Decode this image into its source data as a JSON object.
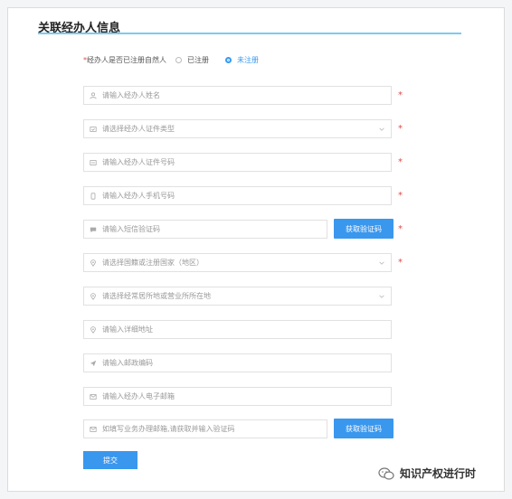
{
  "section": {
    "title": "关联经办人信息"
  },
  "registration": {
    "required_mark": "*",
    "label": "经办人是否已注册自然人",
    "options": [
      "已注册",
      "未注册"
    ],
    "selected": "未注册"
  },
  "form": {
    "fields": [
      {
        "placeholder": "请输入经办人姓名",
        "icon": "user-icon",
        "required": true
      },
      {
        "placeholder": "请选择经办人证件类型",
        "icon": "id-card-icon",
        "required": true,
        "dropdown": true
      },
      {
        "placeholder": "请输入经办人证件号码",
        "icon": "card-icon",
        "required": true
      },
      {
        "placeholder": "请输入经办人手机号码",
        "icon": "phone-icon",
        "required": true
      },
      {
        "placeholder": "请输入短信验证码",
        "icon": "message-icon",
        "required": true,
        "button": "获取验证码"
      },
      {
        "placeholder": "请选择国籍或注册国家（地区）",
        "icon": "location-icon",
        "required": true,
        "dropdown": true
      },
      {
        "placeholder": "请选择经常居所地或营业所所在地",
        "icon": "location-icon",
        "required": false,
        "dropdown": true
      },
      {
        "placeholder": "请输入详细地址",
        "icon": "location-icon",
        "required": false
      },
      {
        "placeholder": "请输入邮政编码",
        "icon": "send-icon",
        "required": false
      },
      {
        "placeholder": "请输入经办人电子邮箱",
        "icon": "mail-icon",
        "required": false
      },
      {
        "placeholder": "如填写业务办理邮箱,请获取并输入验证码",
        "icon": "mail-icon",
        "required": false,
        "button": "获取验证码"
      }
    ],
    "required_mark": "*",
    "submit_label": "提交"
  },
  "watermark": {
    "text": "知识产权进行时"
  }
}
